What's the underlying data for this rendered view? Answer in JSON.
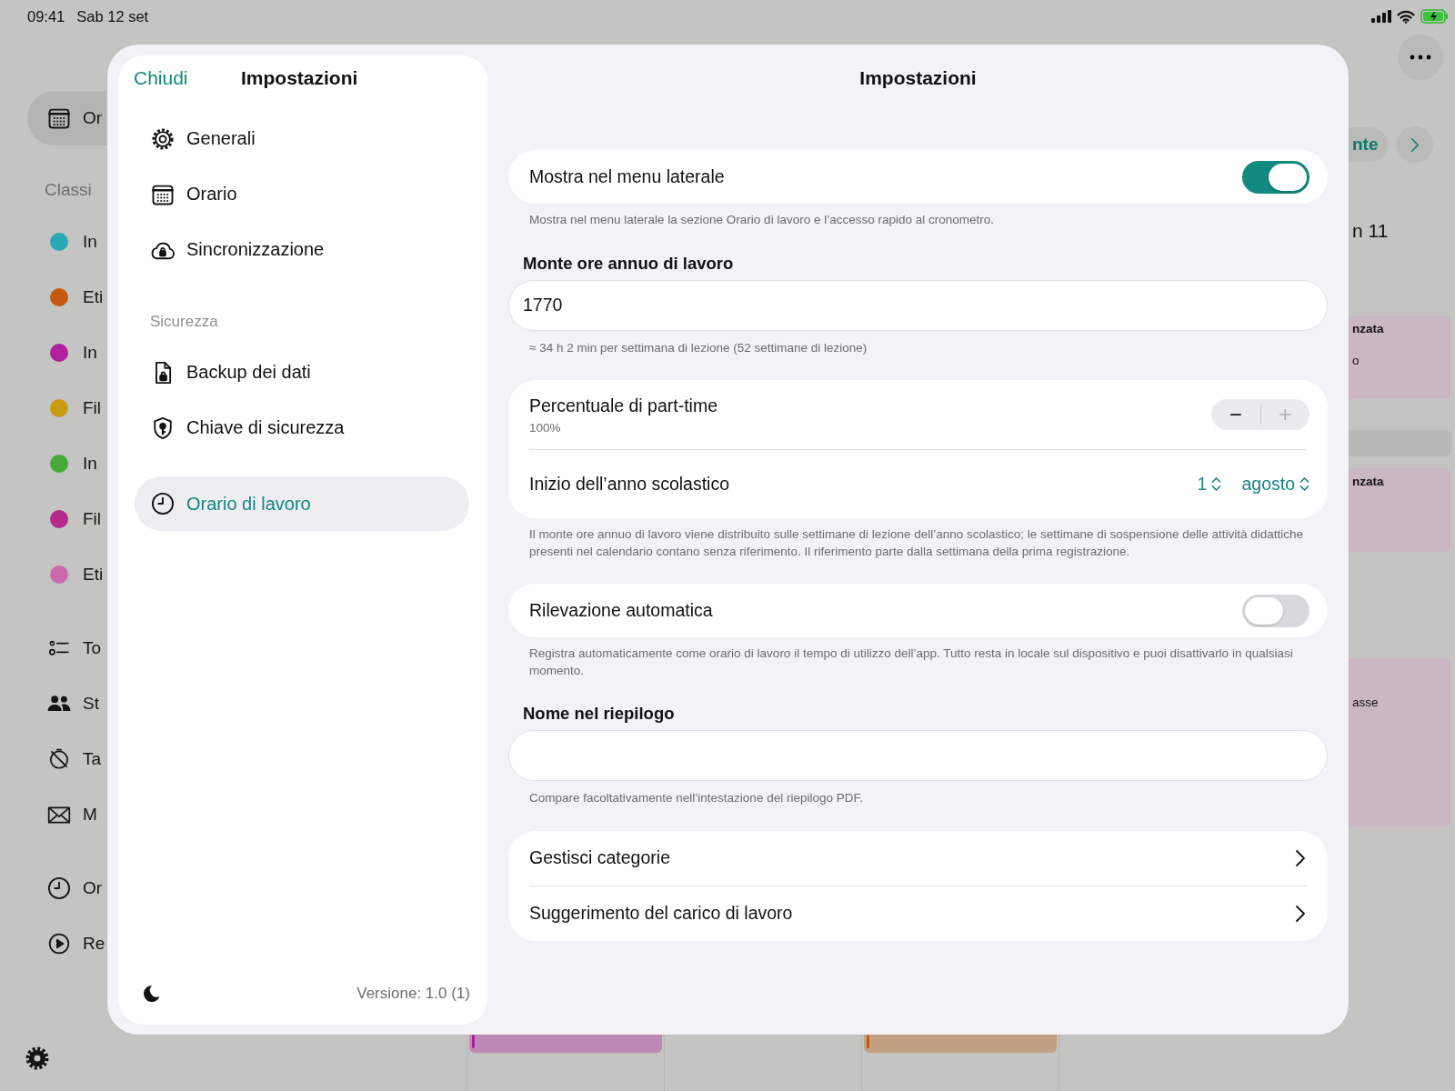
{
  "status_bar": {
    "time": "09:41",
    "date": "Sab 12 set"
  },
  "background": {
    "sidebar": {
      "groups": [
        {
          "items": [
            {
              "kind": "nav",
              "label": "Or",
              "selected": true
            }
          ]
        },
        {
          "header": "Classi",
          "items": [
            {
              "kind": "class",
              "label": "In",
              "color": "#2aa8b8",
              "selected": false
            },
            {
              "kind": "class",
              "label": "Eti",
              "color": "#c6580f",
              "selected": false
            },
            {
              "kind": "class",
              "label": "In",
              "color": "#b0219f",
              "selected": false
            },
            {
              "kind": "class",
              "label": "Fil",
              "color": "#c99b12",
              "selected": false
            },
            {
              "kind": "class",
              "label": "In",
              "color": "#47a93a",
              "selected": false
            },
            {
              "kind": "class",
              "label": "Fil",
              "color": "#b52a8c",
              "selected": false
            },
            {
              "kind": "class",
              "label": "Eti",
              "color": "#c96aae",
              "selected": false
            }
          ]
        },
        {
          "items": [
            {
              "kind": "nav",
              "label": "To",
              "selected": false
            },
            {
              "kind": "nav",
              "label": "St",
              "selected": false
            },
            {
              "kind": "nav",
              "label": "Ta",
              "selected": false
            },
            {
              "kind": "nav",
              "label": "M",
              "selected": false
            }
          ]
        },
        {
          "items": [
            {
              "kind": "nav",
              "label": "Or",
              "selected": false
            },
            {
              "kind": "nav",
              "label": "Re",
              "selected": false
            }
          ]
        }
      ]
    },
    "toolbar_button": "nte",
    "week_label": "n 11",
    "events": [
      {
        "kind": "event",
        "lines": [
          {
            "kind": "title",
            "text": "nzata"
          },
          {
            "kind": "detail",
            "text": "o"
          }
        ]
      },
      {
        "kind": "bar"
      },
      {
        "kind": "event",
        "lines": [
          {
            "kind": "title",
            "text": "nzata"
          }
        ]
      },
      {
        "kind": "event",
        "lines": [
          {
            "kind": "detail",
            "text": "asse"
          }
        ]
      }
    ],
    "bottom_events": [
      {
        "color": "#b01ca0"
      },
      {
        "color": "#c45a0a"
      }
    ]
  },
  "settings_nav": {
    "close": "Chiudi",
    "title": "Impostazioni",
    "sections": [
      {
        "items": [
          {
            "label": "Generali",
            "selected": false
          },
          {
            "label": "Orario",
            "selected": false
          },
          {
            "label": "Sincronizzazione",
            "selected": false
          }
        ]
      },
      {
        "header": "Sicurezza",
        "items": [
          {
            "label": "Backup dei dati",
            "selected": false
          },
          {
            "label": "Chiave di sicurezza",
            "selected": false
          }
        ]
      },
      {
        "items": [
          {
            "label": "Orario di lavoro",
            "selected": true
          }
        ]
      }
    ],
    "version": "Versione: 1.0 (1)"
  },
  "settings_pane": {
    "title": "Impostazioni",
    "sections": [
      {
        "kind": "card",
        "rows": [
          {
            "kind": "toggle",
            "label": "Mostra nel menu laterale",
            "on": true
          }
        ],
        "footer": "Mostra nel menu laterale la sezione Orario di lavoro e l’accesso rapido al cronometro."
      },
      {
        "kind": "field",
        "header": "Monte ore annuo di lavoro",
        "value": "1770",
        "footer": "≈ 34 h 2 min per settimana di lezione (52 settimane di lezione)"
      },
      {
        "kind": "card",
        "rows": [
          {
            "kind": "stepper",
            "label": "Percentuale di part-time",
            "detail": "100%",
            "decrement": {
              "label": "−",
              "disabled": false
            },
            "increment": {
              "label": "+",
              "disabled": true
            }
          },
          {
            "kind": "pickers",
            "label": "Inizio dell’anno scolastico",
            "pickers": [
              "1",
              "agosto"
            ]
          }
        ],
        "footer": "Il monte ore annuo di lavoro viene distribuito sulle settimane di lezione dell’anno scolastico; le settimane di sospensione delle attività didattiche presenti nel calendario contano senza riferimento. Il riferimento parte dalla settimana della prima registrazione."
      },
      {
        "kind": "card",
        "rows": [
          {
            "kind": "toggle",
            "label": "Rilevazione automatica",
            "on": false
          }
        ],
        "footer": "Registra automaticamente come orario di lavoro il tempo di utilizzo dell’app. Tutto resta in locale sul dispositivo e puoi disattivarlo in qualsiasi momento."
      },
      {
        "kind": "field",
        "header": "Nome nel riepilogo",
        "footer": "Compare facoltativamente nell’intestazione del riepilogo PDF."
      },
      {
        "kind": "card",
        "rows": [
          {
            "kind": "link",
            "label": "Gestisci categorie"
          },
          {
            "kind": "link",
            "label": "Suggerimento del carico di lavoro"
          }
        ]
      }
    ]
  }
}
